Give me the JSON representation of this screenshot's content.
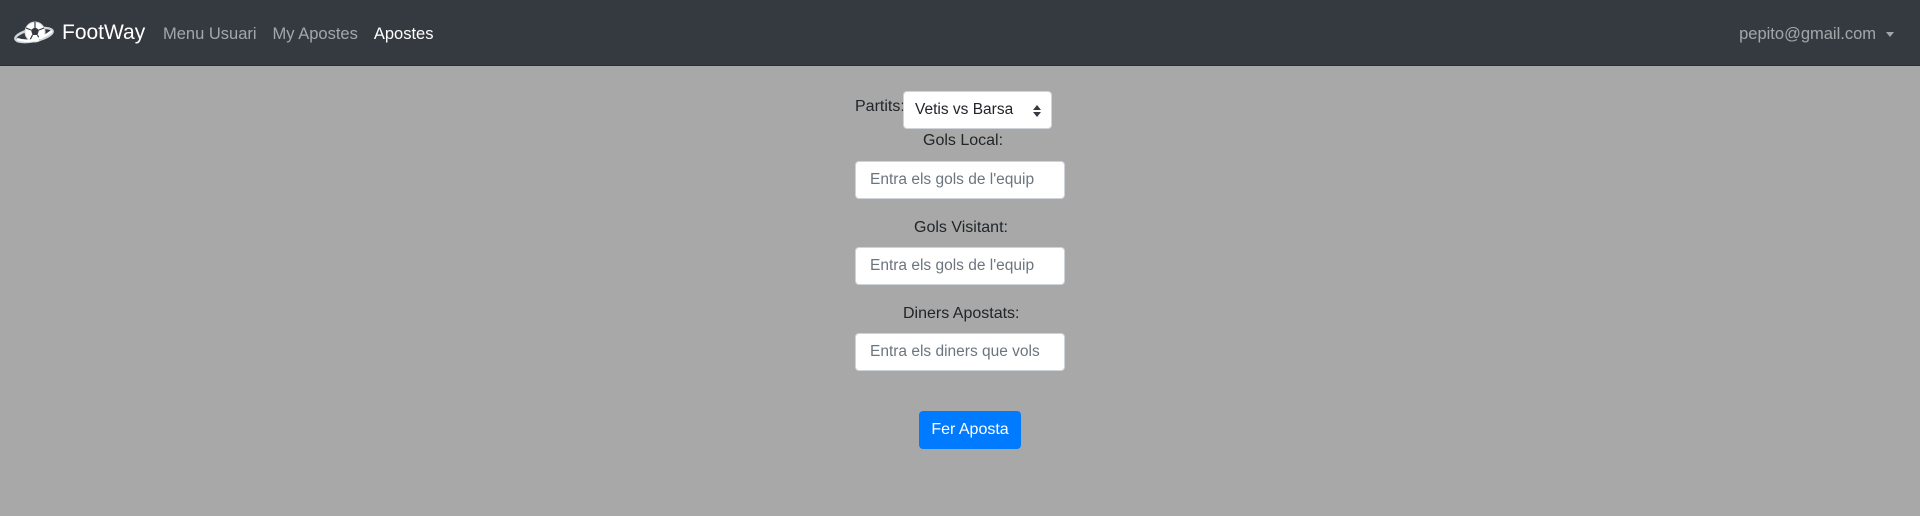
{
  "navbar": {
    "brand": "FootWay",
    "logo_icon": "soccer-ball-planet-icon",
    "links": [
      {
        "label": "Menu Usuari",
        "active": false
      },
      {
        "label": "My Apostes",
        "active": false
      },
      {
        "label": "Apostes",
        "active": true
      }
    ],
    "user": "pepito@gmail.com"
  },
  "form": {
    "match_label": "Partits:",
    "match_selected": "Vetis vs Barsa",
    "home_goals_label": "Gols Local:",
    "home_goals_placeholder": "Entra els gols de l'equip",
    "away_goals_label": "Gols Visitant:",
    "away_goals_placeholder": "Entra els gols de l'equip",
    "money_label": "Diners Apostats:",
    "money_placeholder": "Entra els diners que vols",
    "submit_label": "Fer Aposta"
  },
  "colors": {
    "navbar": "#343a40",
    "background": "#a8a8a8",
    "primary_button": "#007bff"
  }
}
